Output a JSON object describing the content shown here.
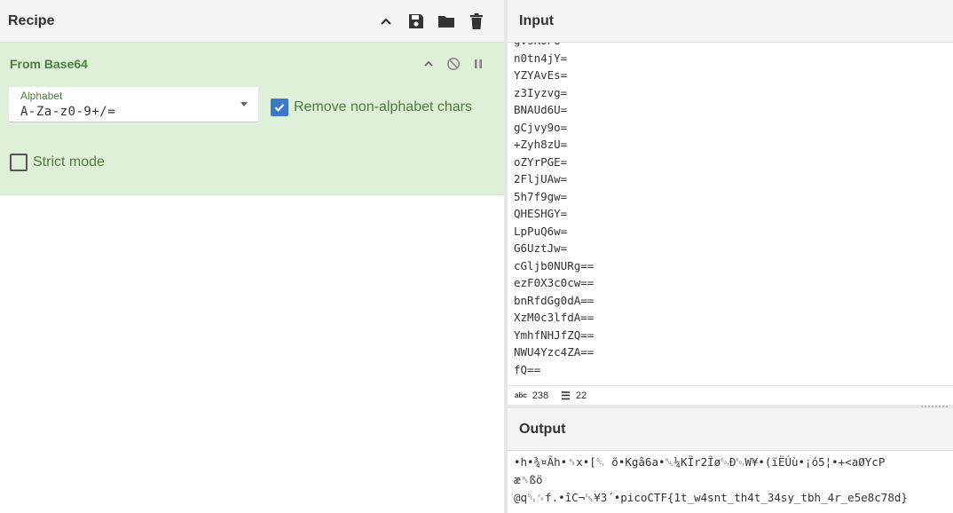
{
  "recipe": {
    "title": "Recipe",
    "operation": {
      "name": "From Base64",
      "alphabet_label": "Alphabet",
      "alphabet_value": "A-Za-z0-9+/=",
      "remove_non_alphabet_label": "Remove non-alphabet chars",
      "remove_non_alphabet_checked": true,
      "strict_mode_label": "Strict mode",
      "strict_mode_checked": false
    }
  },
  "input": {
    "title": "Input",
    "lines": [
      "gvsKOPU=",
      "n0tn4jY=",
      "YZYAvEs=",
      "z3Iyzvg=",
      "BNAUd6U=",
      "gCjvy9o=",
      "+Zyh8zU=",
      "oZYrPGE=",
      "2FljUAw=",
      "5h7f9gw=",
      "QHESHGY=",
      "LpPuQ6w=",
      "G6UztJw=",
      "cGljb0NURg==",
      "ezF0X3c0cw==",
      "bnRfdGg0dA==",
      "XzM0c3lfdA==",
      "YmhfNHJfZQ==",
      "NWU4Yzc4ZA==",
      "fQ=="
    ],
    "status": {
      "chars_label": "abc",
      "chars": "238",
      "lines": "22"
    }
  },
  "output": {
    "title": "Output",
    "lines": [
      "•h•¾¤Ãh•␞x•[␑ õ•Kgâ6a•␀¼KÏr2Îø␄Ð␄W¥•(ïËÚù•¡ó5¦•+<aØYcP",
      "æ␞ßö",
      "@q␒␜f.•îC¬␛¥3´•picoCTF{1t_w4snt_th4t_34sy_tbh_4r_e5e8c78d}"
    ]
  }
}
